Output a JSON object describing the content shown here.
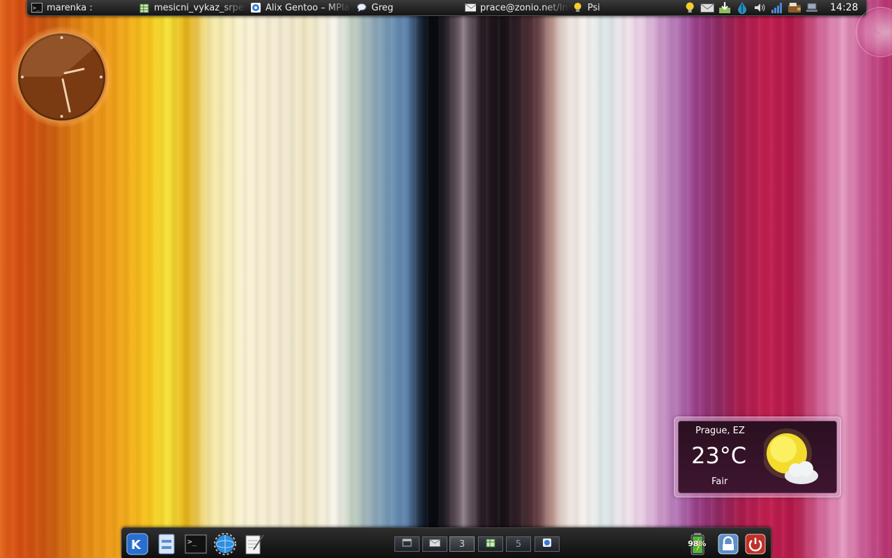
{
  "top_panel": {
    "tasks": [
      {
        "label": "marenka :",
        "icon": "terminal-icon"
      },
      {
        "label": "mesicni_vykaz_srpen",
        "icon": "spreadsheet-icon"
      },
      {
        "label": "Alix Gentoo – MPlayer",
        "icon": "browser-icon"
      },
      {
        "label": "Greg",
        "icon": "chat-bubble-icon"
      },
      {
        "label": "prace@zonio.net/Inbox",
        "icon": "mail-icon"
      },
      {
        "label": "Psi",
        "icon": "lightbulb-icon"
      }
    ],
    "tray": [
      "psi-status-icon",
      "mail-notify-icon",
      "download-icon",
      "network-drop-icon",
      "volume-icon",
      "signal-bars-icon",
      "wallet-icon",
      "laptop-icon"
    ],
    "clock": "14:28"
  },
  "weather": {
    "location": "Prague, EZ",
    "temperature": "23°C",
    "condition": "Fair",
    "icon": "sun-cloud-icon"
  },
  "bottom_panel": {
    "launchers": [
      "kde-menu-icon",
      "file-manager-icon",
      "terminal-icon",
      "web-browser-icon",
      "text-editor-icon"
    ],
    "pager": [
      {
        "label": "",
        "icon": "window-icon"
      },
      {
        "label": "",
        "icon": "mail-icon"
      },
      {
        "label": "3",
        "icon": ""
      },
      {
        "label": "",
        "icon": "spreadsheet-icon"
      },
      {
        "label": "5",
        "icon": ""
      },
      {
        "label": "",
        "icon": "browser-icon"
      }
    ],
    "battery": "98%",
    "actions": [
      "lock-screen-icon",
      "power-icon"
    ]
  },
  "colors": {
    "panel": "#1a1a1a",
    "accent_orange": "#f0a020",
    "power_red": "#c0302a"
  }
}
